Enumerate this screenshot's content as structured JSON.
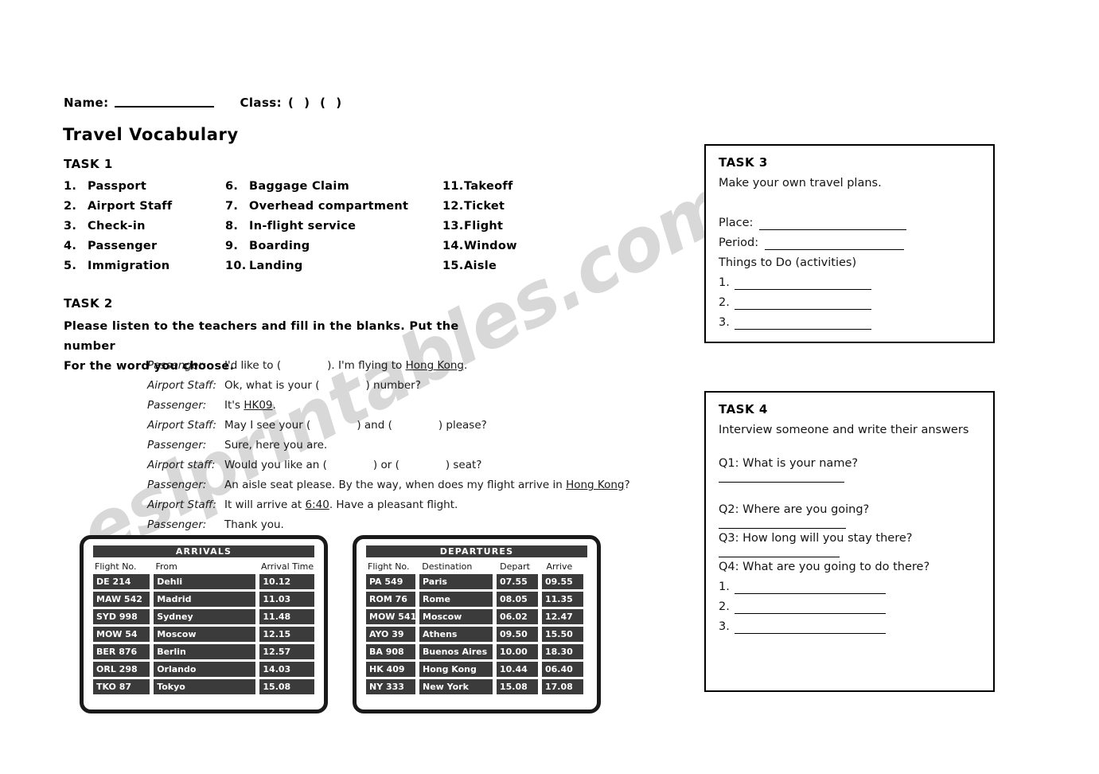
{
  "watermark": "eslprintables.com",
  "header": {
    "name_label": "Name:",
    "class_label": "Class:",
    "class_parens": "( )  ( )",
    "title": "Travel Vocabulary"
  },
  "task1": {
    "heading": "TASK 1",
    "columns": [
      [
        {
          "num": "1.",
          "label": "Passport"
        },
        {
          "num": "2.",
          "label": "Airport Staff"
        },
        {
          "num": "3.",
          "label": "Check-in"
        },
        {
          "num": "4.",
          "label": "Passenger"
        },
        {
          "num": "5.",
          "label": "Immigration"
        }
      ],
      [
        {
          "num": "6.",
          "label": "Baggage Claim"
        },
        {
          "num": "7.",
          "label": "Overhead compartment"
        },
        {
          "num": "8.",
          "label": "In-flight service"
        },
        {
          "num": "9.",
          "label": "Boarding"
        },
        {
          "num": "10.",
          "label": "Landing"
        }
      ],
      [
        {
          "num": "11.",
          "label": "Takeoff"
        },
        {
          "num": "12.",
          "label": "Ticket"
        },
        {
          "num": "13.",
          "label": "Flight"
        },
        {
          "num": "14.",
          "label": "Window"
        },
        {
          "num": "15.",
          "label": "Aisle"
        }
      ]
    ]
  },
  "task2": {
    "heading": "TASK 2",
    "instructions_line1": "Please listen to the teachers and fill in the blanks. Put the number",
    "instructions_line2": "For the word you choose.",
    "dialogue": [
      {
        "speaker": "Passenger:",
        "segments": [
          {
            "t": "I'd like to ("
          },
          {
            "t": "blank"
          },
          {
            "t": "). I'm flying to "
          },
          {
            "t": "Hong Kong",
            "u": true
          },
          {
            "t": "."
          }
        ]
      },
      {
        "speaker": "Airport Staff:",
        "segments": [
          {
            "t": "Ok, what is your ("
          },
          {
            "t": "blank"
          },
          {
            "t": ") number?"
          }
        ]
      },
      {
        "speaker": "Passenger:",
        "segments": [
          {
            "t": "It's "
          },
          {
            "t": "HK09",
            "u": true
          },
          {
            "t": "."
          }
        ]
      },
      {
        "speaker": "Airport Staff:",
        "segments": [
          {
            "t": "May I see your ("
          },
          {
            "t": "blank"
          },
          {
            "t": ") and ("
          },
          {
            "t": "blank"
          },
          {
            "t": ") please?"
          }
        ]
      },
      {
        "speaker": "Passenger:",
        "segments": [
          {
            "t": "Sure, here you are."
          }
        ]
      },
      {
        "speaker": "Airport staff:",
        "segments": [
          {
            "t": "Would you like an ("
          },
          {
            "t": "blank"
          },
          {
            "t": ") or ("
          },
          {
            "t": "blank"
          },
          {
            "t": ") seat?"
          }
        ]
      },
      {
        "speaker": "Passenger:",
        "segments": [
          {
            "t": "An aisle seat please. By the way, when does my flight arrive in "
          },
          {
            "t": "Hong Kong",
            "u": true
          },
          {
            "t": "?"
          }
        ]
      },
      {
        "speaker": "Airport Staff:",
        "segments": [
          {
            "t": "It will arrive at "
          },
          {
            "t": "6:40",
            "u": true
          },
          {
            "t": ". Have a pleasant flight."
          }
        ]
      },
      {
        "speaker": "Passenger:",
        "segments": [
          {
            "t": "Thank you."
          }
        ]
      }
    ]
  },
  "arrivals_board": {
    "title": "ARRIVALS",
    "columns": [
      "Flight No.",
      "From",
      "Arrival Time"
    ],
    "rows": [
      [
        "DE 214",
        "Dehli",
        "10.12"
      ],
      [
        "MAW 542",
        "Madrid",
        "11.03"
      ],
      [
        "SYD 998",
        "Sydney",
        "11.48"
      ],
      [
        "MOW 54",
        "Moscow",
        "12.15"
      ],
      [
        "BER 876",
        "Berlin",
        "12.57"
      ],
      [
        "ORL 298",
        "Orlando",
        "14.03"
      ],
      [
        "TKO 87",
        "Tokyo",
        "15.08"
      ]
    ]
  },
  "departures_board": {
    "title": "DEPARTURES",
    "columns": [
      "Flight No.",
      "Destination",
      "Depart",
      "Arrive"
    ],
    "rows": [
      [
        "PA 549",
        "Paris",
        "07.55",
        "09.55"
      ],
      [
        "ROM 76",
        "Rome",
        "08.05",
        "11.35"
      ],
      [
        "MOW 541",
        "Moscow",
        "06.02",
        "12.47"
      ],
      [
        "AYO 39",
        "Athens",
        "09.50",
        "15.50"
      ],
      [
        "BA 908",
        "Buenos Aires",
        "10.00",
        "18.30"
      ],
      [
        "HK 409",
        "Hong Kong",
        "10.44",
        "06.40"
      ],
      [
        "NY 333",
        "New York",
        "15.08",
        "17.08"
      ]
    ]
  },
  "task3": {
    "heading": "TASK 3",
    "subtitle": "Make your own travel plans.",
    "place_label": "Place:",
    "period_label": "Period:",
    "things_label": "Things to Do (activities)",
    "numbers": [
      "1.",
      "2.",
      "3."
    ]
  },
  "task4": {
    "heading": "TASK 4",
    "subtitle": "Interview someone and write their answers",
    "q1": "Q1: What is your name?",
    "q2": "Q2: Where are you going?",
    "q3": "Q3: How long will you stay there?",
    "q4": "Q4: What are you going to do there?",
    "numbers": [
      "1.",
      "2.",
      "3."
    ]
  }
}
